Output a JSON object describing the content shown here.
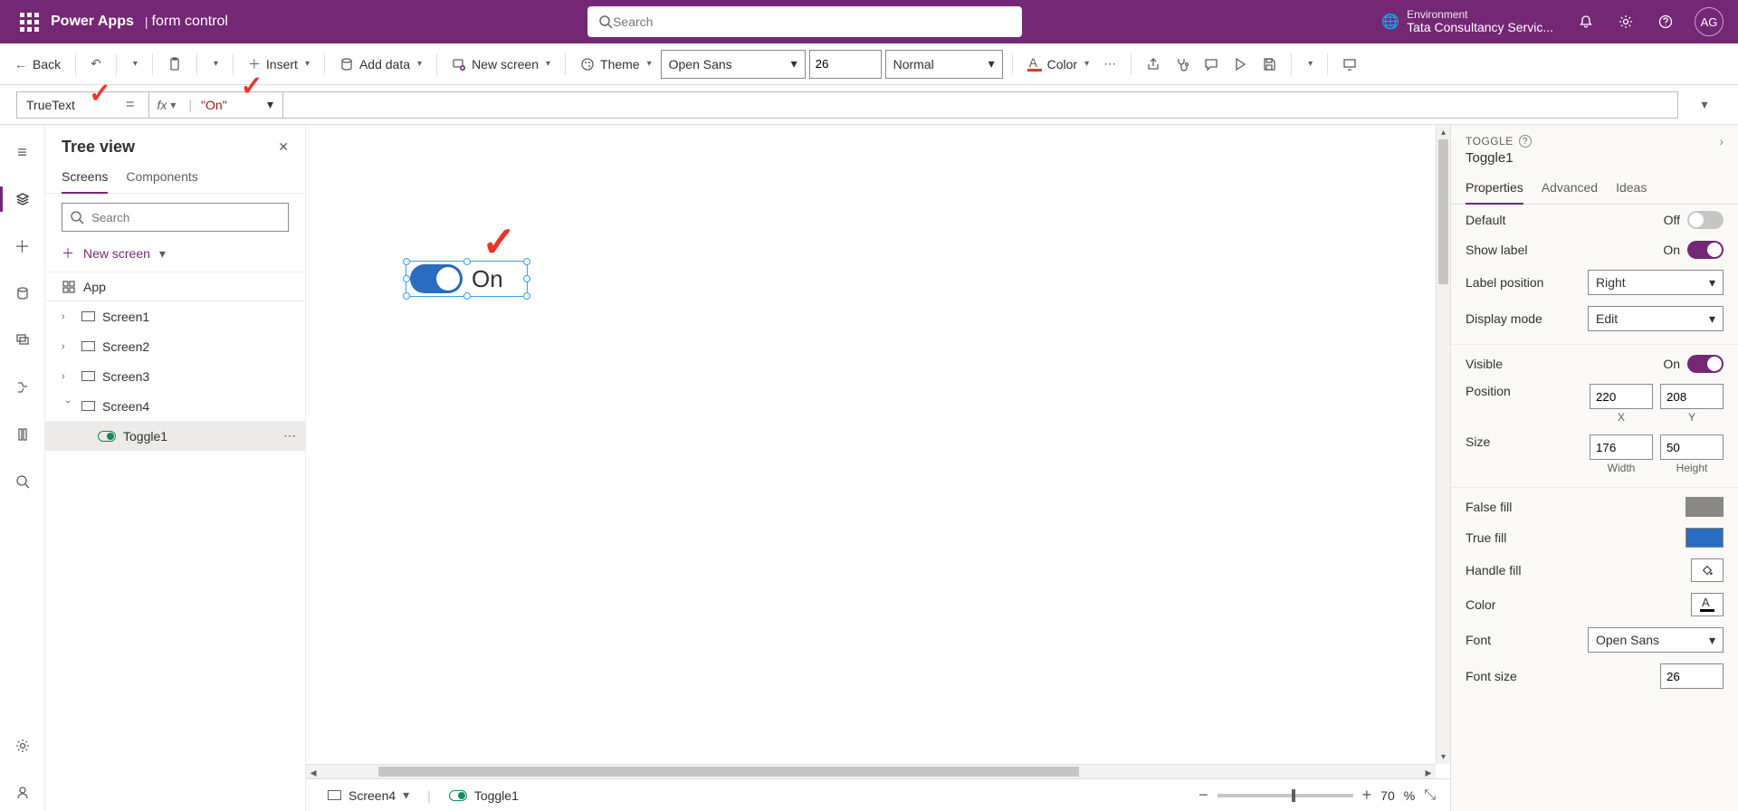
{
  "header": {
    "brand": "Power Apps",
    "separator": "|",
    "appname": "form control",
    "search_placeholder": "Search",
    "environment_label": "Environment",
    "environment_value": "Tata Consultancy Servic...",
    "avatar": "AG"
  },
  "commandbar": {
    "back": "Back",
    "insert": "Insert",
    "add_data": "Add data",
    "new_screen": "New screen",
    "theme": "Theme",
    "font_family": "Open Sans",
    "font_size": "26",
    "font_weight": "Normal",
    "color": "Color"
  },
  "formula": {
    "property": "TrueText",
    "equals": "=",
    "fx": "fx",
    "value": "\"On\""
  },
  "tree": {
    "title": "Tree view",
    "tabs": {
      "screens": "Screens",
      "components": "Components"
    },
    "search_placeholder": "Search",
    "new_screen": "New screen",
    "app": "App",
    "items": [
      "Screen1",
      "Screen2",
      "Screen3",
      "Screen4"
    ],
    "selected_child": "Toggle1"
  },
  "canvas": {
    "toggle_label": "On"
  },
  "status": {
    "screen": "Screen4",
    "control": "Toggle1",
    "zoom": "70",
    "pct": "%"
  },
  "proppane": {
    "category": "TOGGLE",
    "control_name": "Toggle1",
    "tabs": {
      "properties": "Properties",
      "advanced": "Advanced",
      "ideas": "Ideas"
    },
    "default": "Default",
    "default_val": "Off",
    "show_label": "Show label",
    "show_label_val": "On",
    "label_position": "Label position",
    "label_position_val": "Right",
    "display_mode": "Display mode",
    "display_mode_val": "Edit",
    "visible": "Visible",
    "visible_val": "On",
    "position": "Position",
    "x": "220",
    "y": "208",
    "x_lbl": "X",
    "y_lbl": "Y",
    "size": "Size",
    "w": "176",
    "h": "50",
    "w_lbl": "Width",
    "h_lbl": "Height",
    "false_fill": "False fill",
    "true_fill": "True fill",
    "handle_fill": "Handle fill",
    "color": "Color",
    "font": "Font",
    "font_val": "Open Sans",
    "font_size": "Font size",
    "font_size_val": "26"
  },
  "colors": {
    "false_fill": "#8a8886",
    "true_fill": "#2a6cc2"
  }
}
